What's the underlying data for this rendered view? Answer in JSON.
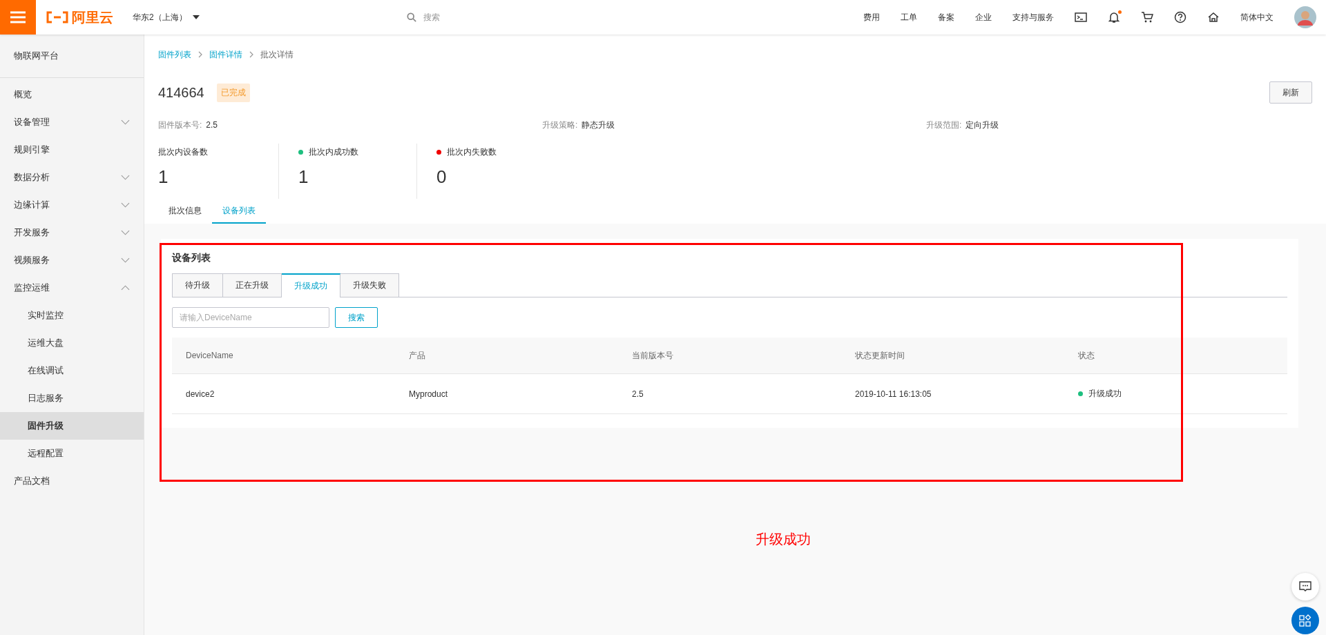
{
  "topbar": {
    "logo": "阿里云",
    "region": "华东2（上海）",
    "search": {
      "placeholder": "搜索"
    },
    "nav": [
      {
        "kind": "text",
        "label": "费用"
      },
      {
        "kind": "text",
        "label": "工单"
      },
      {
        "kind": "text",
        "label": "备案"
      },
      {
        "kind": "text",
        "label": "企业"
      },
      {
        "kind": "text",
        "label": "支持与服务"
      },
      {
        "kind": "terminal"
      },
      {
        "kind": "bell",
        "badge": true
      },
      {
        "kind": "cart"
      },
      {
        "kind": "help"
      },
      {
        "kind": "home"
      },
      {
        "kind": "text",
        "label": "简体中文"
      },
      {
        "kind": "avatar"
      }
    ]
  },
  "sidebar": {
    "title": "物联网平台",
    "items": [
      {
        "kind": "link",
        "label": "概览"
      },
      {
        "kind": "group",
        "label": "设备管理",
        "expanded": false
      },
      {
        "kind": "link",
        "label": "规则引擎"
      },
      {
        "kind": "group",
        "label": "数据分析",
        "expanded": false
      },
      {
        "kind": "group",
        "label": "边缘计算",
        "expanded": false
      },
      {
        "kind": "group",
        "label": "开发服务",
        "expanded": false
      },
      {
        "kind": "group",
        "label": "视频服务",
        "expanded": false
      },
      {
        "kind": "group",
        "label": "监控运维",
        "expanded": true,
        "children": [
          {
            "label": "实时监控",
            "selected": false
          },
          {
            "label": "运维大盘",
            "selected": false
          },
          {
            "label": "在线调试",
            "selected": false
          },
          {
            "label": "日志服务",
            "selected": false
          },
          {
            "label": "固件升级",
            "selected": true
          },
          {
            "label": "远程配置",
            "selected": false
          }
        ]
      },
      {
        "kind": "link",
        "label": "产品文档"
      }
    ]
  },
  "breadcrumb": [
    {
      "label": "固件列表",
      "link": true
    },
    {
      "label": "固件详情",
      "link": true
    },
    {
      "label": "批次详情",
      "link": false
    }
  ],
  "header": {
    "title": "414664",
    "status": "已完成",
    "refresh_button": "刷新"
  },
  "info": [
    {
      "label": "固件版本号:",
      "value": "2.5"
    },
    {
      "label": "升级策略:",
      "value": "静态升级"
    },
    {
      "label": "升级范围:",
      "value": "定向升级"
    }
  ],
  "stats": [
    {
      "label": "批次内设备数",
      "value": "1"
    },
    {
      "label": "批次内成功数",
      "value": "1",
      "color": "#1dbf7f"
    },
    {
      "label": "批次内失败数",
      "value": "0",
      "color": "#f00000"
    }
  ],
  "tabs": [
    {
      "label": "批次信息",
      "selected": false
    },
    {
      "label": "设备列表",
      "selected": true
    }
  ],
  "device_list": {
    "title": "设备列表",
    "tabs": [
      {
        "label": "待升级",
        "selected": false
      },
      {
        "label": "正在升级",
        "selected": false
      },
      {
        "label": "升级成功",
        "selected": true
      },
      {
        "label": "升级失败",
        "selected": false
      }
    ],
    "search": {
      "placeholder": "请输入DeviceName",
      "button": "搜索"
    },
    "table": {
      "columns": [
        "DeviceName",
        "产品",
        "当前版本号",
        "状态更新时间",
        "状态"
      ],
      "rows": [
        {
          "cells": [
            "device2",
            "Myproduct",
            "2.5",
            "2019-10-11 16:13:05"
          ],
          "status": {
            "label": "升级成功",
            "color": "#1dbf7f"
          }
        }
      ]
    }
  },
  "annotation": {
    "text": "升级成功"
  }
}
